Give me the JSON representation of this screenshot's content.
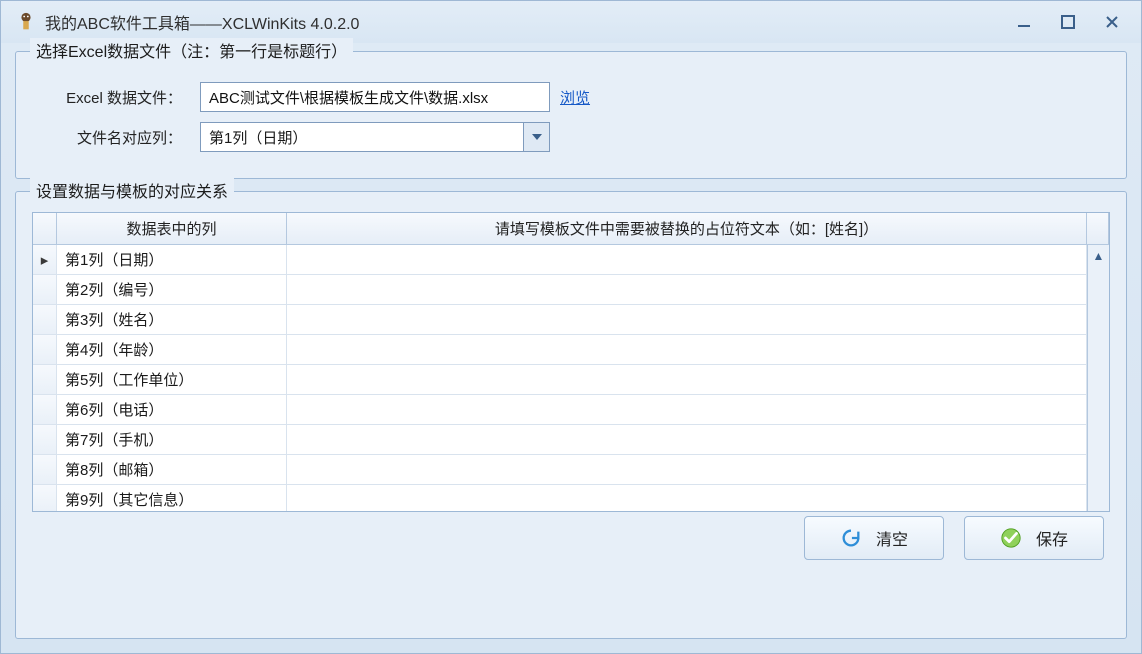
{
  "window": {
    "title": "我的ABC软件工具箱——XCLWinKits  4.0.2.0"
  },
  "group1": {
    "legend": "选择Excel数据文件（注：第一行是标题行）",
    "excel_label": "Excel 数据文件：",
    "excel_path": "ABC测试文件\\根据模板生成文件\\数据.xlsx",
    "browse": "浏览",
    "filename_col_label": "文件名对应列：",
    "filename_col_value": "第1列（日期）"
  },
  "group2": {
    "legend": "设置数据与模板的对应关系",
    "header_col1": "数据表中的列",
    "header_col2": "请填写模板文件中需要被替换的占位符文本（如：[姓名]）",
    "rows": [
      {
        "col": "第1列（日期）",
        "placeholder": ""
      },
      {
        "col": "第2列（编号）",
        "placeholder": ""
      },
      {
        "col": "第3列（姓名）",
        "placeholder": ""
      },
      {
        "col": "第4列（年龄）",
        "placeholder": ""
      },
      {
        "col": "第5列（工作单位）",
        "placeholder": ""
      },
      {
        "col": "第6列（电话）",
        "placeholder": ""
      },
      {
        "col": "第7列（手机）",
        "placeholder": ""
      },
      {
        "col": "第8列（邮箱）",
        "placeholder": ""
      },
      {
        "col": "第9列（其它信息）",
        "placeholder": ""
      }
    ]
  },
  "footer": {
    "clear": "清空",
    "save": "保存"
  }
}
